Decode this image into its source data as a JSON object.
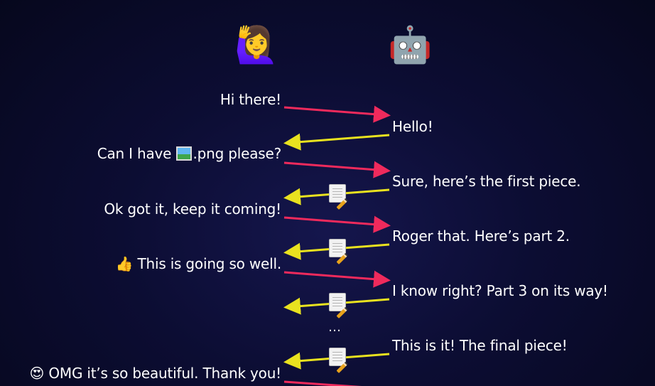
{
  "avatars": {
    "user": "🙋‍♀️",
    "bot": "🤖"
  },
  "icons": {
    "document_with_pencil": "document-pencil-icon",
    "image_file": "framed-picture-icon"
  },
  "colors": {
    "request_arrow": "#ef2a5c",
    "response_arrow": "#e9e21f"
  },
  "messages": [
    {
      "side": "left",
      "text": "Hi there!"
    },
    {
      "side": "right",
      "text": "Hello!"
    },
    {
      "side": "left",
      "text_before": "Can I have ",
      "emoji": "🖼️",
      "text_after": ".png please?"
    },
    {
      "side": "right",
      "text": "Sure, here’s the first piece."
    },
    {
      "side": "left",
      "text": "Ok got it, keep it coming!"
    },
    {
      "side": "right",
      "text": "Roger that. Here’s part 2."
    },
    {
      "side": "left",
      "emoji": "👍",
      "text": "This is going so well."
    },
    {
      "side": "right",
      "text": "I know right? Part 3 on its way!"
    },
    {
      "side": "right",
      "text": "This is it! The final piece!"
    },
    {
      "side": "left",
      "emoji": "😍",
      "text": "OMG it’s so beautiful. Thank you!"
    }
  ],
  "ellipsis": "…"
}
